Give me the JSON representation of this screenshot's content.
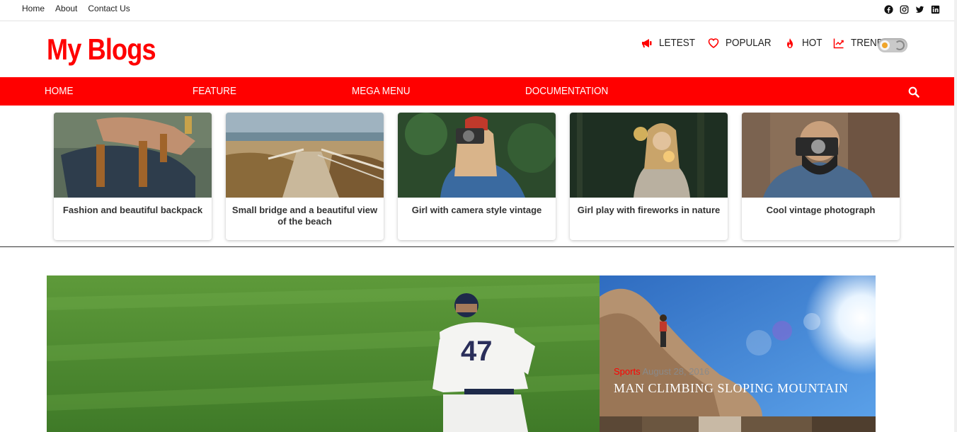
{
  "topbar": {
    "links": [
      "Home",
      "About",
      "Contact Us"
    ],
    "social_icons": [
      "facebook-icon",
      "instagram-icon",
      "twitter-icon",
      "linkedin-icon"
    ]
  },
  "header": {
    "logo": "My Blogs",
    "nav": [
      {
        "label": "LETEST",
        "icon": "megaphone-icon"
      },
      {
        "label": "POPULAR",
        "icon": "heart-icon"
      },
      {
        "label": "HOT",
        "icon": "fire-icon"
      },
      {
        "label": "TRENDING",
        "icon": "trending-icon"
      }
    ],
    "theme_toggle": "light"
  },
  "menu": {
    "items": [
      "HOME",
      "FEATURE",
      "MEGA MENU",
      "DOCUMENTATION"
    ],
    "search_icon": "search-icon"
  },
  "cards": [
    {
      "caption": "Fashion and beautiful backpack"
    },
    {
      "caption": "Small bridge and a beautiful view of the beach"
    },
    {
      "caption": "Girl with camera style vintage"
    },
    {
      "caption": "Girl play with fireworks in nature"
    },
    {
      "caption": "Cool vintage photograph"
    }
  ],
  "hero": {
    "side": {
      "category": "Sports",
      "date": "August 28, 2016",
      "title": "MAN CLIMBING SLOPING MOUNTAIN"
    }
  },
  "colors": {
    "accent": "#ff0000",
    "text": "#222222"
  }
}
